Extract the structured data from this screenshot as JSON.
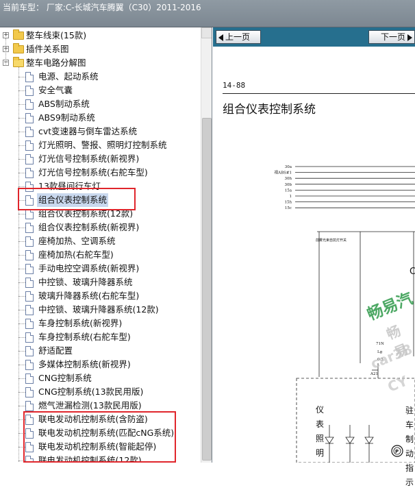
{
  "titlebar": {
    "text": "当前车型：  厂家:C-长城汽车腾翼（C30）2011-2016"
  },
  "tree": {
    "folders": [
      {
        "label": "整车线束(15款)",
        "expander": "+"
      },
      {
        "label": "插件关系图",
        "expander": "+"
      },
      {
        "label": "整车电路分解图",
        "expander": "−"
      }
    ],
    "items": [
      "电源、起动系统",
      "安全气囊",
      "ABS制动系统",
      "ABS9制动系统",
      "cvt变速器与倒车雷达系统",
      "灯光照明、警报、照明灯控制系统",
      "灯光信号控制系统(新视界)",
      "灯光信号控制系统(右舵车型)",
      "13款昼间行车灯",
      "组合仪表控制系统",
      "组合仪表控制系统(12款)",
      "组合仪表控制系统(新视界)",
      "座椅加热、空调系统",
      "座椅加热(右舵车型)",
      "手动电控空调系统(新视界)",
      "中控锁、玻璃升降器系统",
      "玻璃升降器系统(右舵车型)",
      "中控锁、玻璃升降器系统(12款)",
      "车身控制系统(新视界)",
      "车身控制系统(右舵车型)",
      "舒适配置",
      "多媒体控制系统(新视界)",
      "CNG控制系统",
      "CNG控制系统(13款民用版)",
      "燃气泄漏检测(13款民用版)",
      "联电发动机控制系统(含防盗)",
      "联电发动机控制系统(匹配cNG系统)",
      "联电发动机控制系统(智能起停)",
      "联电发动机控制系统(12款)"
    ],
    "selected_index": 9
  },
  "viewer": {
    "prev_label": "上一页",
    "next_label": "下一页",
    "page_number": "14-88",
    "page_title": "组合仪表控制系统",
    "wire_labels": [
      "30a",
      "视ABS#1",
      "30h",
      "30b",
      "15a",
      "1",
      "15h",
      "15c"
    ],
    "bus_label": "前雾光束自抗灯开关",
    "small_labels": {
      "c_letter": "C",
      "n71": "71N",
      "lg": "Lg",
      "v05": "0.5",
      "a21": "A21"
    },
    "vertical_left": "仪表照明",
    "vertical_right": "驻车制动指示",
    "watermarks": {
      "main": "畅易汽",
      "sub": "畅易",
      "url": "car38",
      "cy": "CY"
    },
    "p_symbol": "P"
  },
  "colors": {
    "toolbar": "#266f8e",
    "titlebar": "#8f9aa3",
    "highlight_box": "#e0252b",
    "watermark_green": "#2f9a4a"
  }
}
